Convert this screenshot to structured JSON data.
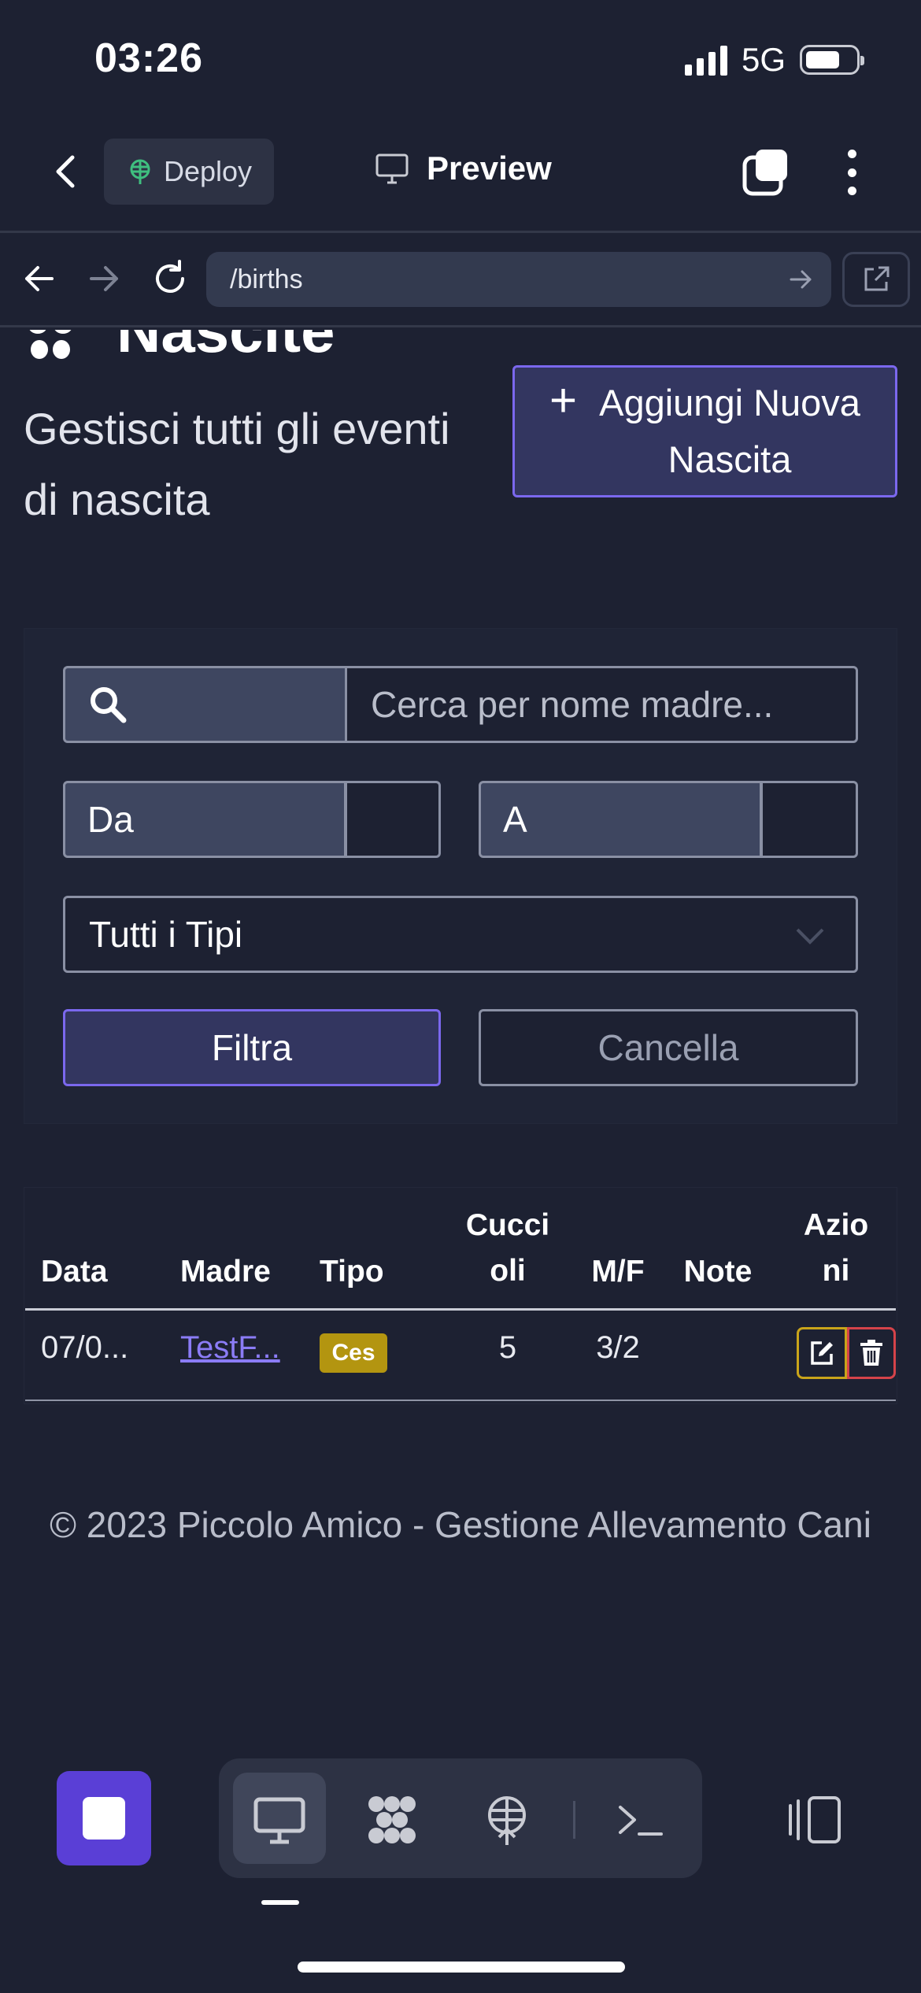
{
  "status": {
    "time": "03:26",
    "network": "5G"
  },
  "toolbar": {
    "deploy_label": "Deploy",
    "preview_label": "Preview"
  },
  "browser": {
    "url": "/births"
  },
  "page": {
    "title": "Nascite",
    "subtitle": "Gestisci tutti gli eventi di nascita",
    "add_button_line1": "Aggiungi Nuova",
    "add_button_line2": "Nascita"
  },
  "filters": {
    "search_placeholder": "Cerca per nome madre...",
    "from_label": "Da",
    "to_label": "A",
    "type_selected": "Tutti i Tipi",
    "filter_label": "Filtra",
    "cancel_label": "Cancella"
  },
  "table": {
    "headers": {
      "date": "Data",
      "mother": "Madre",
      "type": "Tipo",
      "puppies_1": "Cucci",
      "puppies_2": "oli",
      "mf": "M/F",
      "notes": "Note",
      "actions_1": "Azio",
      "actions_2": "ni"
    },
    "rows": [
      {
        "date": "07/0...",
        "mother": "TestF...",
        "type": "Ces",
        "puppies": "5",
        "mf": "3/2",
        "notes": ""
      }
    ]
  },
  "footer": {
    "text": "© 2023 Piccolo Amico - Gestione Allevamento Cani"
  },
  "colors": {
    "background": "#1d2132",
    "accent": "#7b68ee",
    "badge": "#b39510",
    "edit": "#c9a41a",
    "delete": "#d5434a"
  }
}
